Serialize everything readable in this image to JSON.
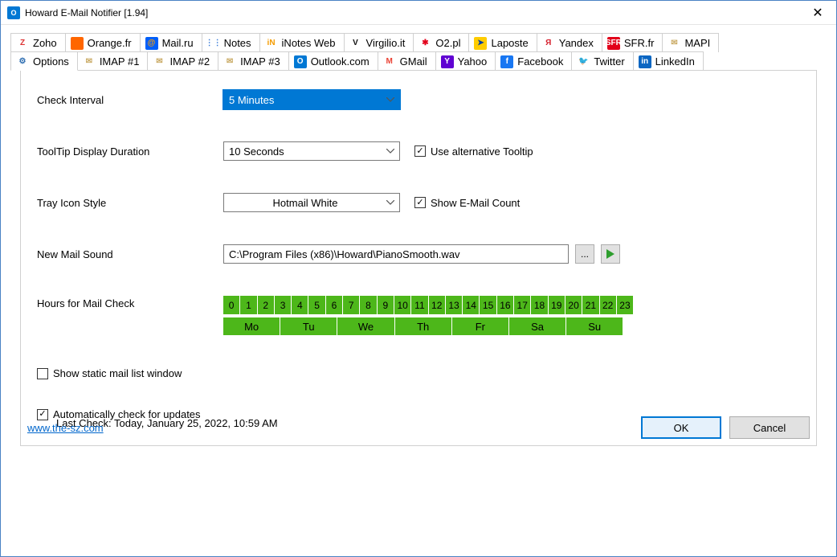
{
  "window": {
    "title": "Howard E-Mail Notifier [1.94]"
  },
  "tabs_row1": [
    {
      "label": "Zoho",
      "icon_bg": "#fff",
      "icon_txt": "Z",
      "icon_color": "#d33"
    },
    {
      "label": "Orange.fr",
      "icon_bg": "#ff6600",
      "icon_txt": "",
      "icon_color": "#fff"
    },
    {
      "label": "Mail.ru",
      "icon_bg": "#005ff9",
      "icon_txt": "@",
      "icon_color": "#ff9d00"
    },
    {
      "label": "Notes",
      "icon_bg": "#fff",
      "icon_txt": "⋮⋮",
      "icon_color": "#3b7dd8"
    },
    {
      "label": "iNotes Web",
      "icon_bg": "#fff",
      "icon_txt": "iN",
      "icon_color": "#f49b00"
    },
    {
      "label": "Virgilio.it",
      "icon_bg": "#fff",
      "icon_txt": "V",
      "icon_color": "#111"
    },
    {
      "label": "O2.pl",
      "icon_bg": "#fff",
      "icon_txt": "✱",
      "icon_color": "#e2001a"
    },
    {
      "label": "Laposte",
      "icon_bg": "#ffcc00",
      "icon_txt": "➤",
      "icon_color": "#003da5"
    },
    {
      "label": "Yandex",
      "icon_bg": "#fff",
      "icon_txt": "Я",
      "icon_color": "#d61f2c"
    },
    {
      "label": "SFR.fr",
      "icon_bg": "#e2001a",
      "icon_txt": "SFR",
      "icon_color": "#fff"
    },
    {
      "label": "MAPI",
      "icon_bg": "#fff",
      "icon_txt": "✉",
      "icon_color": "#c9a962"
    }
  ],
  "tabs_row2": [
    {
      "label": "Options",
      "icon_bg": "#fff",
      "icon_txt": "⚙",
      "icon_color": "#2b6cb0",
      "active": true
    },
    {
      "label": "IMAP #1",
      "icon_bg": "#fff",
      "icon_txt": "✉",
      "icon_color": "#c9a962"
    },
    {
      "label": "IMAP #2",
      "icon_bg": "#fff",
      "icon_txt": "✉",
      "icon_color": "#c9a962"
    },
    {
      "label": "IMAP #3",
      "icon_bg": "#fff",
      "icon_txt": "✉",
      "icon_color": "#c9a962"
    },
    {
      "label": "Outlook.com",
      "icon_bg": "#0078d4",
      "icon_txt": "O",
      "icon_color": "#fff"
    },
    {
      "label": "GMail",
      "icon_bg": "#fff",
      "icon_txt": "M",
      "icon_color": "#ea4335"
    },
    {
      "label": "Yahoo",
      "icon_bg": "#6001d2",
      "icon_txt": "Y",
      "icon_color": "#fff"
    },
    {
      "label": "Facebook",
      "icon_bg": "#1877f2",
      "icon_txt": "f",
      "icon_color": "#fff"
    },
    {
      "label": "Twitter",
      "icon_bg": "#fff",
      "icon_txt": "🐦",
      "icon_color": "#1da1f2"
    },
    {
      "label": "LinkedIn",
      "icon_bg": "#0a66c2",
      "icon_txt": "in",
      "icon_color": "#fff"
    }
  ],
  "form": {
    "check_interval": {
      "label": "Check Interval",
      "value": "5 Minutes"
    },
    "tooltip_duration": {
      "label": "ToolTip Display Duration",
      "value": "10 Seconds",
      "alt_label": "Use alternative Tooltip",
      "alt_checked": true
    },
    "tray_icon": {
      "label": "Tray Icon Style",
      "value": "Hotmail White",
      "count_label": "Show E-Mail Count",
      "count_checked": true
    },
    "sound": {
      "label": "New Mail Sound",
      "path": "C:\\Program Files (x86)\\Howard\\PianoSmooth.wav",
      "browse": "...",
      "play": "▶"
    },
    "hours": {
      "label": "Hours for Mail Check",
      "hours_list": [
        "0",
        "1",
        "2",
        "3",
        "4",
        "5",
        "6",
        "7",
        "8",
        "9",
        "10",
        "11",
        "12",
        "13",
        "14",
        "15",
        "16",
        "17",
        "18",
        "19",
        "20",
        "21",
        "22",
        "23"
      ],
      "days_list": [
        "Mo",
        "Tu",
        "We",
        "Th",
        "Fr",
        "Sa",
        "Su"
      ]
    },
    "static_list": {
      "label": "Show static mail list window",
      "checked": false
    },
    "auto_update": {
      "label": "Automatically check for updates",
      "checked": true
    },
    "last_check": "Last Check: Today, January 25, 2022, 10:59 AM"
  },
  "footer": {
    "link": "www.the-sz.com",
    "ok": "OK",
    "cancel": "Cancel"
  }
}
